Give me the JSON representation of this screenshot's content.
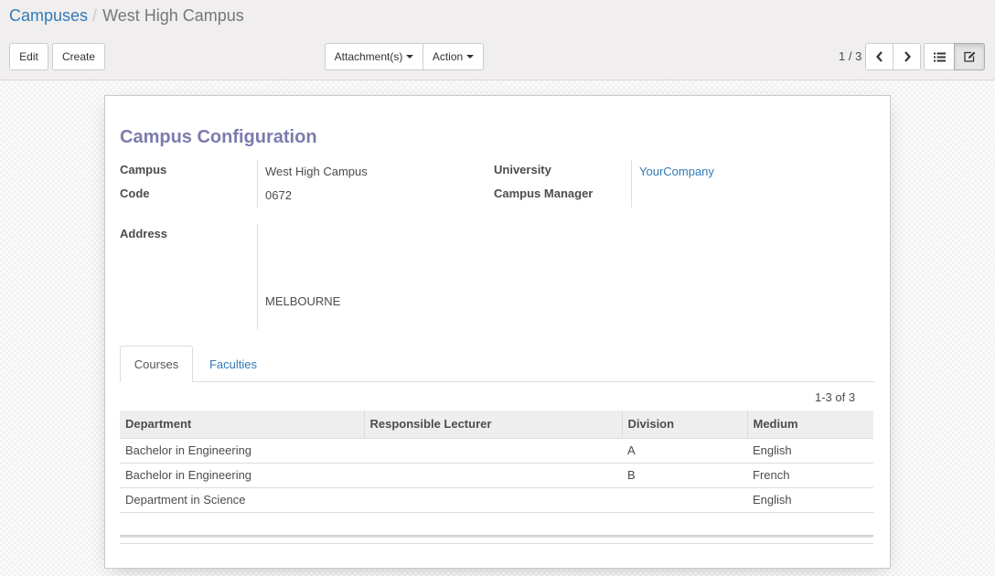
{
  "breadcrumb": {
    "parent": "Campuses",
    "separator": "/",
    "current": "West High Campus"
  },
  "toolbar": {
    "edit_label": "Edit",
    "create_label": "Create",
    "attachments_label": "Attachment(s)",
    "action_label": "Action"
  },
  "pager": {
    "value": "1 / 3"
  },
  "form": {
    "title": "Campus Configuration",
    "campus_label": "Campus",
    "campus_value": "West High Campus",
    "code_label": "Code",
    "code_value": "0672",
    "university_label": "University",
    "university_value": "YourCompany",
    "manager_label": "Campus Manager",
    "manager_value": "",
    "address_label": "Address",
    "address_value": "MELBOURNE"
  },
  "tabs": [
    {
      "label": "Courses",
      "active": true
    },
    {
      "label": "Faculties",
      "active": false
    }
  ],
  "courses": {
    "pager": "1-3 of 3",
    "columns": [
      "Department",
      "Responsible Lecturer",
      "Division",
      "Medium"
    ],
    "rows": [
      [
        "Bachelor in Engineering",
        "",
        "A",
        "English"
      ],
      [
        "Bachelor in Engineering",
        "",
        "B",
        "French"
      ],
      [
        "Department in Science",
        "",
        "",
        "English"
      ]
    ]
  },
  "colors": {
    "link": "#337ab7",
    "title": "#7c7bad",
    "panel_bg": "#f0eeee"
  },
  "icons": {
    "prev": "chevron-left-icon",
    "next": "chevron-right-icon",
    "list_view": "list-icon",
    "form_view": "edit-icon"
  }
}
